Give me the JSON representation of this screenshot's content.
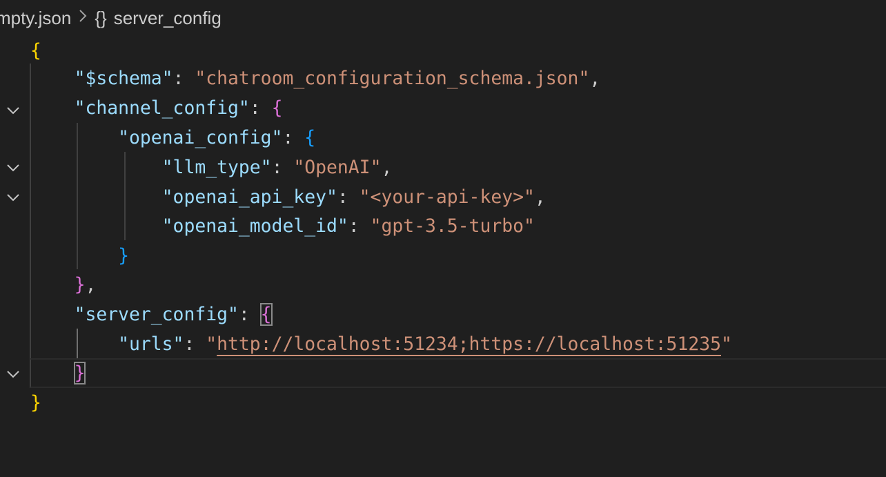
{
  "breadcrumb": {
    "file": "mpty.json",
    "separator": ">",
    "object_icon": "{}",
    "symbol": "server_config"
  },
  "code": {
    "open_root": "{",
    "schema_key": "\"$schema\"",
    "schema_value": "\"chatroom_configuration_schema.json\"",
    "channel_key": "\"channel_config\"",
    "open_channel": "{",
    "openai_key": "\"openai_config\"",
    "open_openai": "{",
    "llm_type_key": "\"llm_type\"",
    "llm_type_value": "\"OpenAI\"",
    "api_key_key": "\"openai_api_key\"",
    "api_key_value": "\"<your-api-key>\"",
    "model_key": "\"openai_model_id\"",
    "model_value": "\"gpt-3.5-turbo\"",
    "close_openai": "}",
    "close_channel": "}",
    "server_key": "\"server_config\"",
    "open_server": "{",
    "urls_key": "\"urls\"",
    "urls_value": "http://localhost:51234;https://localhost:51235",
    "close_server": "}",
    "close_root": "}"
  },
  "icons": {
    "fold": "chevron-down-icon",
    "breadcrumb_separator": "chevron-right-icon",
    "object_symbol": "braces-icon"
  },
  "colors": {
    "background": "#1f1f1f",
    "json_key": "#9cdcfe",
    "json_string": "#ce9178",
    "bracket_level1": "#ffd700",
    "bracket_level2": "#da70d6",
    "bracket_level3": "#179fff"
  }
}
